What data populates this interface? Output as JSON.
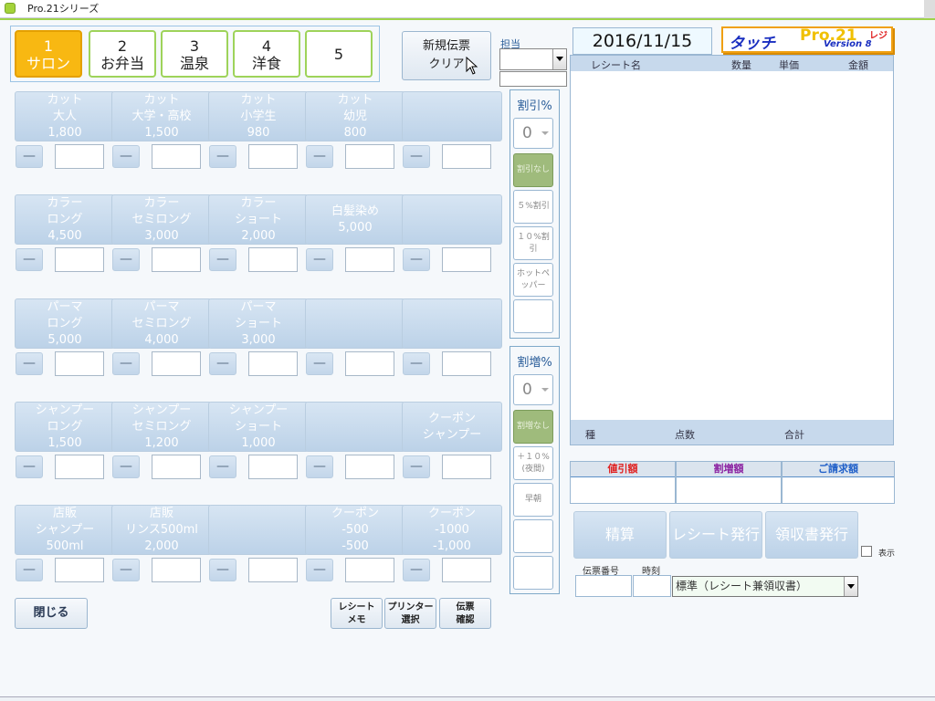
{
  "window": {
    "title": "Pro.21シリーズ"
  },
  "tabs": [
    {
      "num": "1",
      "label": "サロン",
      "active": true
    },
    {
      "num": "2",
      "label": "お弁当",
      "active": false
    },
    {
      "num": "3",
      "label": "温泉",
      "active": false
    },
    {
      "num": "4",
      "label": "洋食",
      "active": false
    },
    {
      "num": "5",
      "label": "",
      "active": false
    }
  ],
  "new_slip": {
    "line1": "新規伝票",
    "line2": "クリア"
  },
  "staff": {
    "label": "担当",
    "value": ""
  },
  "date": "2016/11/15",
  "logo": {
    "main": "タッチ",
    "product": "Pro.21",
    "suffix": "レジ",
    "version": "Version 8"
  },
  "products": [
    [
      [
        "カット",
        "大人",
        "1,800"
      ],
      [
        "カット",
        "大学・高校",
        "1,500"
      ],
      [
        "カット",
        "小学生",
        "980"
      ],
      [
        "カット",
        "幼児",
        "800"
      ],
      []
    ],
    [
      [
        "カラー",
        "ロング",
        "4,500"
      ],
      [
        "カラー",
        "セミロング",
        "3,000"
      ],
      [
        "カラー",
        "ショート",
        "2,000"
      ],
      [
        "白髪染め",
        "",
        "5,000"
      ],
      []
    ],
    [
      [
        "パーマ",
        "ロング",
        "5,000"
      ],
      [
        "パーマ",
        "セミロング",
        "4,000"
      ],
      [
        "パーマ",
        "ショート",
        "3,000"
      ],
      [],
      []
    ],
    [
      [
        "シャンプー",
        "ロング",
        "1,500"
      ],
      [
        "シャンプー",
        "セミロング",
        "1,200"
      ],
      [
        "シャンプー",
        "ショート",
        "1,000"
      ],
      [],
      [
        "クーポン",
        "シャンプー"
      ]
    ],
    [
      [
        "店販",
        "シャンプー",
        "500ml"
      ],
      [
        "店販",
        "リンス500ml",
        "2,000"
      ],
      [],
      [
        "クーポン",
        "-500",
        "-500"
      ],
      [
        "クーポン",
        "-1000",
        "-1,000"
      ]
    ]
  ],
  "minus_symbol": "—",
  "discount": {
    "title": "割引%",
    "value": "0",
    "buttons": [
      "割引なし",
      "５%割引",
      "１０%割引",
      "ホットペッパー",
      ""
    ]
  },
  "surcharge": {
    "title": "割増%",
    "value": "0",
    "buttons": [
      "割増なし",
      "＋１０%(夜間)",
      "早朝",
      "",
      ""
    ]
  },
  "receipt": {
    "headers": [
      "レシート名",
      "数量",
      "単価",
      "金額"
    ],
    "footer": [
      "種",
      "点数",
      "合計"
    ]
  },
  "totals": [
    {
      "label": "値引額",
      "color": "#e02020"
    },
    {
      "label": "割増額",
      "color": "#8a1fa0"
    },
    {
      "label": "ご請求額",
      "color": "#1f5fc8"
    }
  ],
  "actions": [
    "精算",
    "レシート発行",
    "領収書発行"
  ],
  "display_check": "表示",
  "slip_number_label": "伝票番号",
  "time_label": "時刻",
  "print_mode": "標準（レシート兼領収書）",
  "close_button": "閉じる",
  "bottom_buttons": [
    [
      "レシート",
      "メモ"
    ],
    [
      "プリンター",
      "選択"
    ],
    [
      "伝票",
      "確認"
    ]
  ]
}
